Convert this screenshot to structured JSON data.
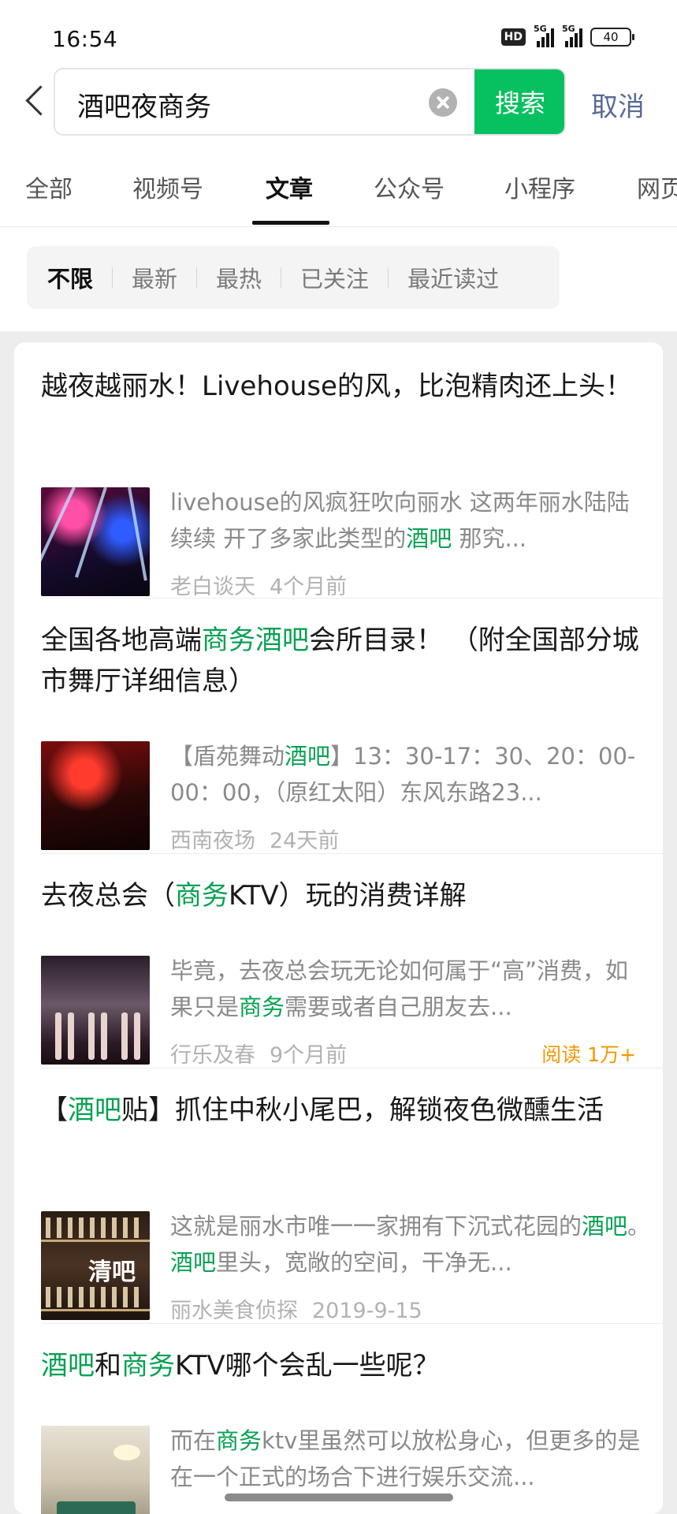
{
  "status_bar": {
    "time": "16:54",
    "hd_badge": "HD",
    "signal1_label": "5G",
    "signal2_label": "5G",
    "battery": "40"
  },
  "search": {
    "query": "酒吧夜商务",
    "button_label": "搜索",
    "cancel_label": "取消"
  },
  "tabs": [
    "全部",
    "视频号",
    "文章",
    "公众号",
    "小程序",
    "网页"
  ],
  "active_tab": "文章",
  "filters": [
    "不限",
    "最新",
    "最热",
    "已关注",
    "最近读过"
  ],
  "active_filter": "不限",
  "accent_color": "#07c160",
  "highlight_color": "#07a152",
  "results": [
    {
      "title_parts": [
        {
          "t": "越夜越丽水！Livehouse的风，比泡精肉还上头！",
          "hl": false
        }
      ],
      "snippet_parts": [
        {
          "t": "livehouse的风疯狂吹向丽水 这两年丽水陆陆续续 开了多家此类型的",
          "hl": false
        },
        {
          "t": "酒吧",
          "hl": true
        },
        {
          "t": " 那究...",
          "hl": false
        }
      ],
      "source": "老白谈天",
      "date": "4个月前",
      "reads": "",
      "thumb_icon": "nightclub-stage-photo"
    },
    {
      "title_parts": [
        {
          "t": "全国各地高端",
          "hl": false
        },
        {
          "t": "商务酒吧",
          "hl": true
        },
        {
          "t": "会所目录！ （附全国部分城市舞厅详细信息）",
          "hl": false
        }
      ],
      "snippet_parts": [
        {
          "t": "【盾苑舞动",
          "hl": false
        },
        {
          "t": "酒吧",
          "hl": true
        },
        {
          "t": "】13：30-17：30、20：00-00：00，（原红太阳）东风东路23...",
          "hl": false
        }
      ],
      "source": "西南夜场",
      "date": "24天前",
      "reads": "",
      "thumb_icon": "dance-hall-photo"
    },
    {
      "title_parts": [
        {
          "t": "去夜总会（",
          "hl": false
        },
        {
          "t": "商务",
          "hl": true
        },
        {
          "t": "KTV）玩的消费详解",
          "hl": false
        }
      ],
      "snippet_parts": [
        {
          "t": "毕竟，去夜总会玩无论如何属于“高”消费，如果只是",
          "hl": false
        },
        {
          "t": "商务",
          "hl": true
        },
        {
          "t": "需要或者自己朋友去...",
          "hl": false
        }
      ],
      "source": "行乐及春",
      "date": "9个月前",
      "reads": "阅读 1万+",
      "thumb_icon": "ktv-hostesses-photo"
    },
    {
      "title_parts": [
        {
          "t": "【",
          "hl": false
        },
        {
          "t": "酒吧",
          "hl": true
        },
        {
          "t": "贴】抓住中秋小尾巴，解锁夜色微醺生活",
          "hl": false
        }
      ],
      "snippet_parts": [
        {
          "t": "这就是丽水市唯一一家拥有下沉式花园的",
          "hl": false
        },
        {
          "t": "酒吧",
          "hl": true
        },
        {
          "t": "。",
          "hl": false
        },
        {
          "t": "酒吧",
          "hl": true
        },
        {
          "t": "里头，宽敞的空间，干净无...",
          "hl": false
        }
      ],
      "source": "丽水美食侦探",
      "date": "2019-9-15",
      "reads": "",
      "thumb_icon": "bar-shelf-photo",
      "thumb_text": "清吧"
    },
    {
      "title_parts": [
        {
          "t": "酒吧",
          "hl": true
        },
        {
          "t": "和",
          "hl": false
        },
        {
          "t": "商务",
          "hl": true
        },
        {
          "t": "KTV哪个会乱一些呢？",
          "hl": false
        }
      ],
      "snippet_parts": [
        {
          "t": "而在",
          "hl": false
        },
        {
          "t": "商务",
          "hl": true
        },
        {
          "t": "ktv里虽然可以放松身心，但更多的是在一个正式的场合下进行娱乐交流...",
          "hl": false
        }
      ],
      "source": "",
      "date": "",
      "reads": "",
      "thumb_icon": "ktv-room-photo"
    }
  ]
}
